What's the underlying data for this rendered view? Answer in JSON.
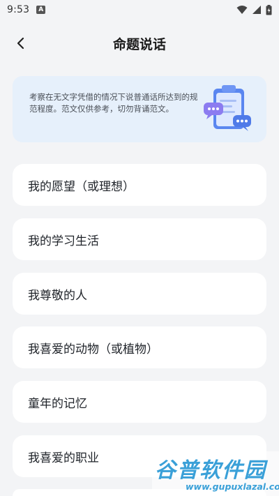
{
  "status_bar": {
    "time": "9:53",
    "notification_badge": "A",
    "icons": [
      "wifi-icon",
      "signal-icon",
      "battery-icon"
    ]
  },
  "header": {
    "title": "命题说话",
    "back_icon": "chevron-left-icon"
  },
  "info_card": {
    "text": "考察在无文字凭借的情况下说普通话所达到的规范程度。范文仅供参考，切勿背诵范文。",
    "illustration": "clipboard-chat-illustration",
    "background": "#e6f0fb"
  },
  "topics": [
    {
      "label": "我的愿望（或理想）"
    },
    {
      "label": "我的学习生活"
    },
    {
      "label": "我尊敬的人"
    },
    {
      "label": "我喜爱的动物（或植物）"
    },
    {
      "label": "童年的记忆"
    },
    {
      "label": "我喜爱的职业"
    },
    {
      "label": ""
    }
  ],
  "watermark": {
    "title": "谷普软件园",
    "url": "www.gupuxlazal.com"
  },
  "colors": {
    "page_bg": "#f3f4f6",
    "card_bg": "#ffffff",
    "watermark": "#3aa0d8"
  }
}
